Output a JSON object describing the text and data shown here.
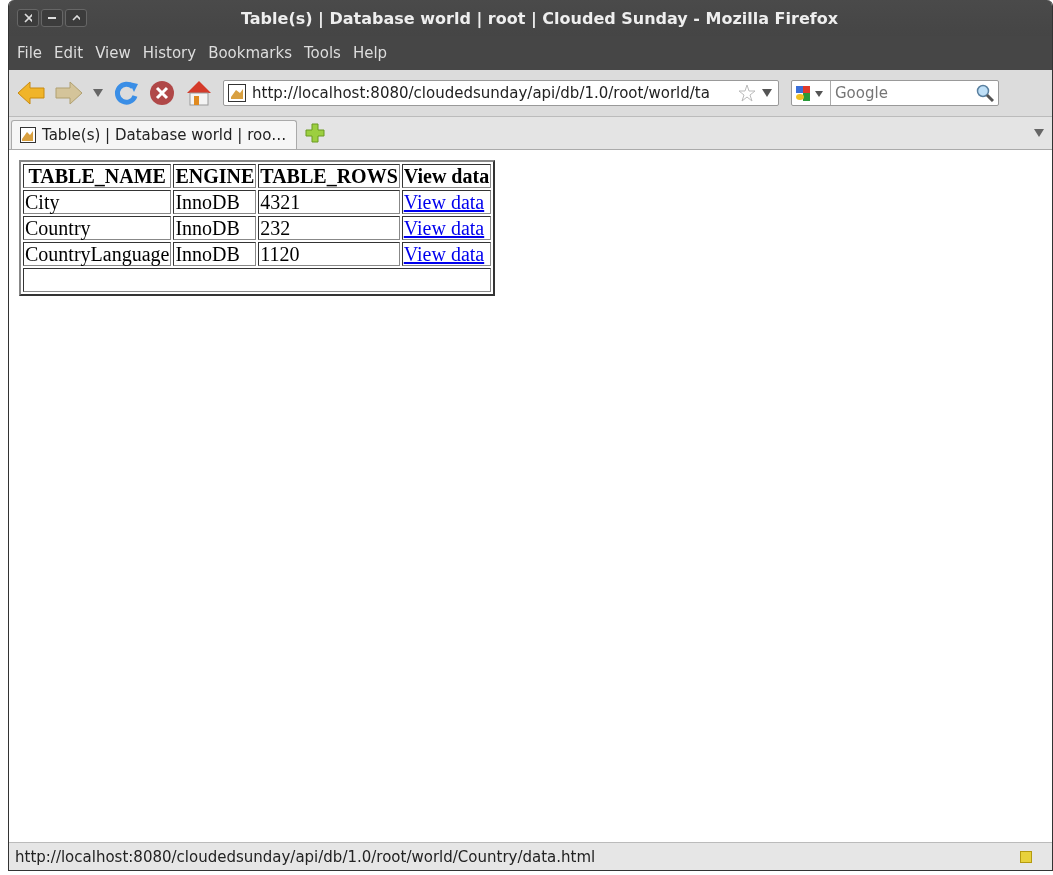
{
  "window": {
    "title": "Table(s) | Database world | root | Clouded Sunday - Mozilla Firefox"
  },
  "menu": [
    "File",
    "Edit",
    "View",
    "History",
    "Bookmarks",
    "Tools",
    "Help"
  ],
  "address_bar": {
    "value": "http://localhost:8080/cloudedsunday/api/db/1.0/root/world/ta"
  },
  "search": {
    "placeholder": "Google"
  },
  "tabs": [
    {
      "label": "Table(s) | Database world | roo…",
      "selected": true
    }
  ],
  "table": {
    "columns": [
      "TABLE_NAME",
      "ENGINE",
      "TABLE_ROWS",
      "View data"
    ],
    "rows": [
      {
        "name": "City",
        "engine": "InnoDB",
        "rows": "4321",
        "link": "View data"
      },
      {
        "name": "Country",
        "engine": "InnoDB",
        "rows": "232",
        "link": "View data"
      },
      {
        "name": "CountryLanguage",
        "engine": "InnoDB",
        "rows": "1120",
        "link": "View data"
      }
    ]
  },
  "status_bar": "http://localhost:8080/cloudedsunday/api/db/1.0/root/world/Country/data.html"
}
